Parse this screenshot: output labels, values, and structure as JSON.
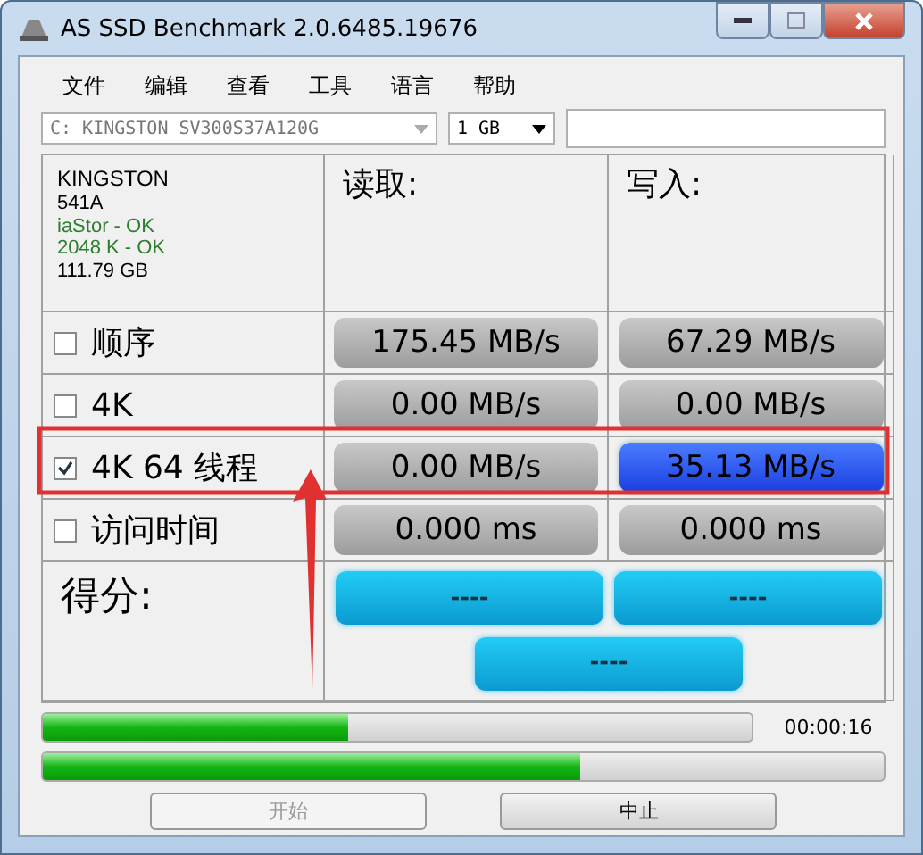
{
  "window": {
    "title": "AS SSD Benchmark 2.0.6485.19676"
  },
  "menu": [
    "文件",
    "编辑",
    "查看",
    "工具",
    "语言",
    "帮助"
  ],
  "drive_select": {
    "value": "C: KINGSTON SV300S37A120G"
  },
  "size_select": {
    "value": "1 GB"
  },
  "drive_info": [
    {
      "text": "KINGSTON",
      "ok": false
    },
    {
      "text": "541A",
      "ok": false
    },
    {
      "text": "iaStor - OK",
      "ok": true
    },
    {
      "text": "2048 K - OK",
      "ok": true
    },
    {
      "text": "111.79 GB",
      "ok": false
    }
  ],
  "columns": [
    "读取:",
    "写入:"
  ],
  "tests": [
    {
      "label": "顺序",
      "checked": false,
      "read": "175.45 MB/s",
      "write": "67.29 MB/s",
      "read_active": false,
      "write_active": false
    },
    {
      "label": "4K",
      "checked": false,
      "read": "0.00 MB/s",
      "write": "0.00 MB/s",
      "read_active": false,
      "write_active": false
    },
    {
      "label": "4K 64 线程",
      "checked": true,
      "read": "0.00 MB/s",
      "write": "35.13 MB/s",
      "read_active": false,
      "write_active": true
    },
    {
      "label": "访问时间",
      "checked": false,
      "read": "0.000 ms",
      "write": "0.000 ms",
      "read_active": false,
      "write_active": false
    }
  ],
  "score": {
    "label": "得分:",
    "read": "----",
    "write": "----",
    "total": "----"
  },
  "progress": [
    {
      "level": 0.43,
      "time": "00:00:16"
    },
    {
      "level": 0.64
    }
  ],
  "buttons": [
    {
      "label": "开始",
      "disabled": true
    },
    {
      "label": "中止",
      "disabled": false
    }
  ]
}
